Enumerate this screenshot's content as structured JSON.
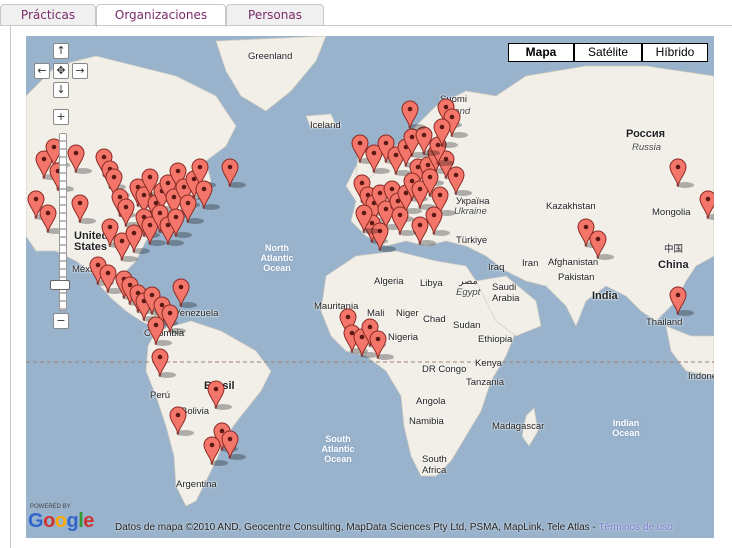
{
  "tabs": [
    {
      "label": "Prácticas",
      "active": false
    },
    {
      "label": "Organizaciones",
      "active": true
    },
    {
      "label": "Personas",
      "active": false
    }
  ],
  "map": {
    "map_types": [
      {
        "label": "Mapa",
        "active": true
      },
      {
        "label": "Satélite",
        "active": false
      },
      {
        "label": "Híbrido",
        "active": false
      }
    ],
    "nav_icons": [
      "arrow-up-icon",
      "arrow-left-icon",
      "recenter-icon",
      "arrow-right-icon",
      "arrow-down-icon",
      "zoom-in-icon",
      "zoom-out-icon"
    ],
    "labels": {
      "greenland": "Greenland",
      "iceland": "Iceland",
      "suomi": "Suomi",
      "finland": "Finland",
      "rossiya": "Россия",
      "russia": "Russia",
      "ukraina": "Україна",
      "ukraine": "Ukraine",
      "kazakhstan": "Kazakhstan",
      "mongolia": "Mongolia",
      "china_native": "中国",
      "china": "China",
      "turkiye": "Türkiye",
      "iran": "Iran",
      "iraq": "Iraq",
      "afghanistan": "Afghanistan",
      "pakistan": "Pakistan",
      "india": "India",
      "thailand": "Thailand",
      "indonesia": "Indone",
      "united_states": "United States",
      "mexico": "México",
      "venezuela": "Venezuela",
      "colombia": "Colombia",
      "brasil": "Brasil",
      "peru": "Perú",
      "bolivia": "Bolivia",
      "argentina": "Argentina",
      "north_atlantic": "North Atlantic Ocean",
      "south_atlantic": "South Atlantic Ocean",
      "indian_ocean": "Indian Ocean",
      "algeria": "Algeria",
      "libya": "Libya",
      "egypt_native": "مصر",
      "egypt": "Egypt",
      "saudi": "Saudi Arabia",
      "mauritania": "Mauritania",
      "mali": "Mali",
      "niger": "Niger",
      "chad": "Chad",
      "sudan": "Sudan",
      "nigeria": "Nigeria",
      "ethiopia": "Ethiopia",
      "kenya": "Kenya",
      "dr_congo": "DR Congo",
      "tanzania": "Tanzania",
      "angola": "Angola",
      "namibia": "Namibia",
      "madagascar": "Madagascar",
      "south_africa": "South Africa"
    },
    "powered_by": "POWERED BY",
    "attribution": "Datos de mapa ©2010 AND, Geocentre Consulting, MapData Sciences Pty Ltd, PSMA, MapLink, Tele Atlas -",
    "terms_link": "Términos de uso",
    "colors": {
      "water": "#99b3cc",
      "land": "#f2efe9",
      "marker": "#f4766b",
      "tab_text": "#7a2b6a"
    }
  }
}
